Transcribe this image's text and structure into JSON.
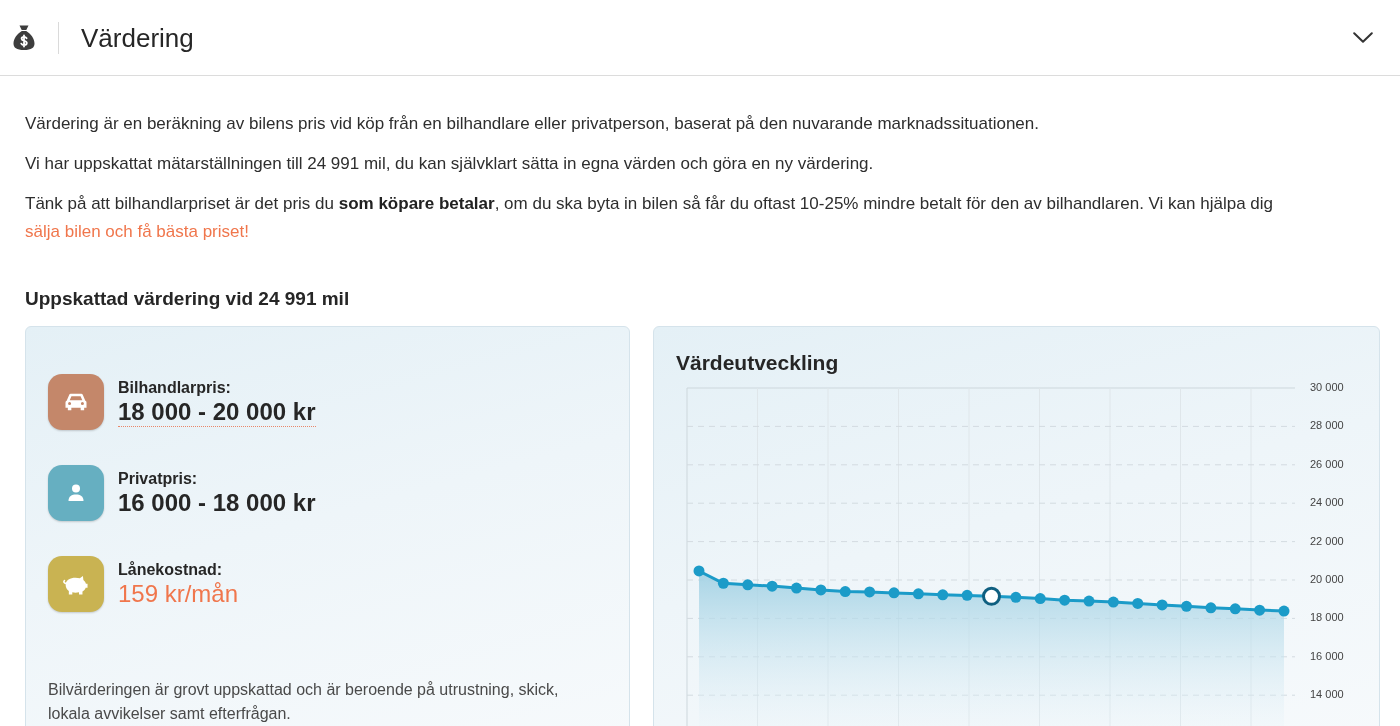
{
  "header": {
    "title": "Värdering",
    "expanded": true
  },
  "paragraphs": [
    {
      "text": "Värdering är en beräkning av bilens pris vid köp från en bilhandlare eller privatperson, baserat på den nuvarande marknadssituationen."
    },
    {
      "text": "Vi har uppskattat mätarställningen till 24 991 mil, du kan självklart sätta in egna värden och göra en ny värdering."
    },
    {
      "text": "Tänk på att bilhandlarpriset är det pris du **som köpare betalar**, om du ska byta in bilen så får du oftast 10-25% mindre betalt för den av bilhandlaren. Vi kan hjälpa dig",
      "link": "sälja bilen och få bästa priset!"
    }
  ],
  "estimate": {
    "heading": "Uppskattad värdering vid 24 991 mil",
    "prices": [
      {
        "kind": "dealer",
        "label": "Bilhandlarpris:",
        "value": "18 000 - 20 000 kr",
        "color": "#c4876a"
      },
      {
        "kind": "private",
        "label": "Privatpris:",
        "value": "16 000 - 18 000 kr",
        "color": "#66afc1"
      },
      {
        "kind": "loan",
        "label": "Lånekostnad:",
        "value": "159 kr/mån",
        "color": "#c9b352"
      }
    ],
    "note": "Bilvärderingen är grovt uppskattad och är beroende på utrustning, skick, lokala avvikelser samt efterfrågan."
  },
  "value_chart": {
    "chart_data": {
      "type": "area",
      "title": "Värdeutveckling",
      "series": [
        {
          "color": "#1b9bc8",
          "values": [
            20470,
            19830,
            19750,
            19680,
            19580,
            19480,
            19400,
            19380,
            19330,
            19280,
            19230,
            19200,
            19150,
            19100,
            19030,
            18950,
            18900,
            18850,
            18780,
            18700,
            18630,
            18550,
            18500,
            18430,
            18380
          ]
        }
      ],
      "ylim": [
        14000,
        30000
      ],
      "yticks": [
        {
          "value": 30000,
          "label": "30 000"
        },
        {
          "value": 28000,
          "label": "28 000"
        },
        {
          "value": 26000,
          "label": "26 000"
        },
        {
          "value": 24000,
          "label": "24 000"
        },
        {
          "value": 22000,
          "label": "22 000"
        },
        {
          "value": 20000,
          "label": "20 000"
        },
        {
          "value": 18000,
          "label": "18 000"
        },
        {
          "value": 16000,
          "label": "16 000"
        },
        {
          "value": 14000,
          "label": "14 000"
        }
      ],
      "grid": true
    },
    "points": [
      {
        "selected": false
      },
      {
        "selected": false
      },
      {
        "selected": false
      },
      {
        "selected": false
      },
      {
        "selected": false
      },
      {
        "selected": false
      },
      {
        "selected": false
      },
      {
        "selected": false
      },
      {
        "selected": false
      },
      {
        "selected": false
      },
      {
        "selected": false
      },
      {
        "selected": false
      },
      {
        "selected": true
      },
      {
        "selected": false
      },
      {
        "selected": false
      },
      {
        "selected": false
      },
      {
        "selected": false
      },
      {
        "selected": false
      },
      {
        "selected": false
      },
      {
        "selected": false
      },
      {
        "selected": false
      },
      {
        "selected": false
      },
      {
        "selected": false
      },
      {
        "selected": false
      },
      {
        "selected": false
      }
    ]
  }
}
